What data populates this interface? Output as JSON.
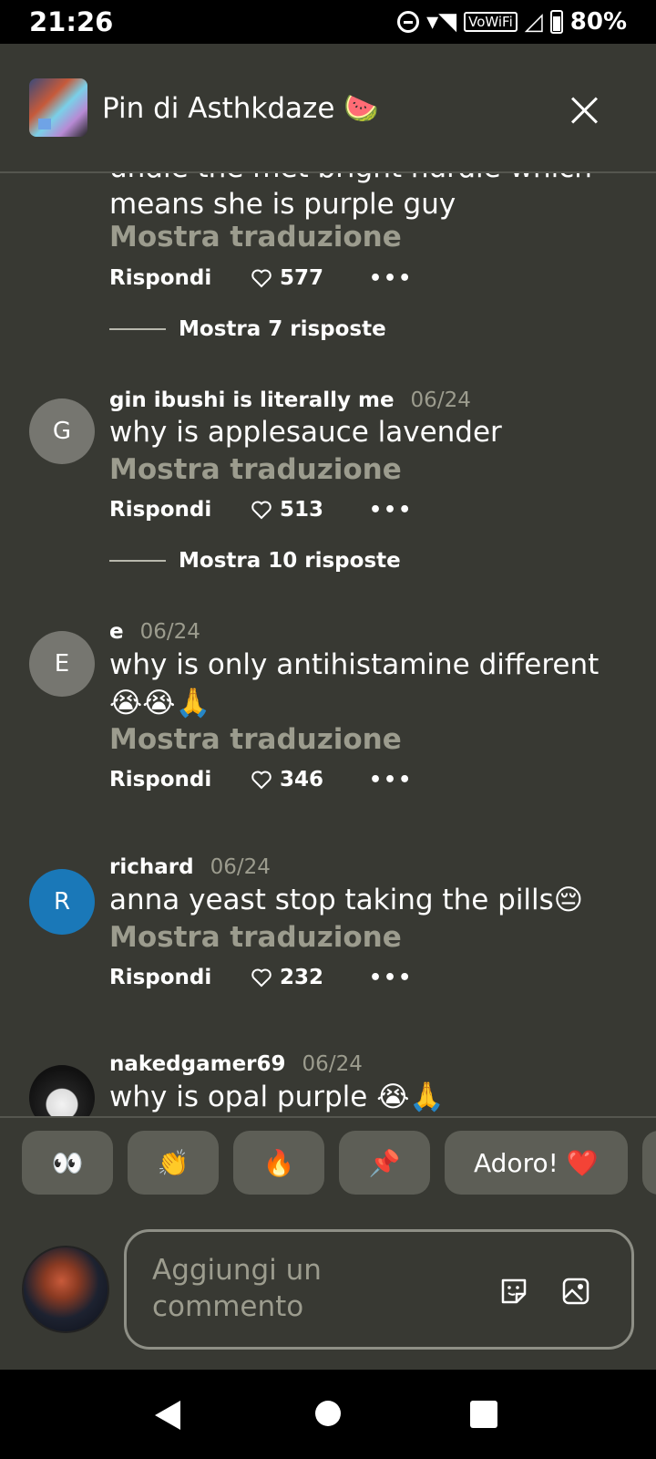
{
  "status_bar": {
    "time": "21:26",
    "network": "VoWiFi",
    "battery": "80%"
  },
  "header": {
    "title": "Pin di Asthkdaze 🍉",
    "close_icon": "close-icon"
  },
  "comments": {
    "partial": {
      "cut_line": "undie the met bright hurdle which",
      "line2": "means she is purple guy",
      "translate": "Mostra traduzione",
      "reply": "Rispondi",
      "likes": "577",
      "show_replies": "Mostra 7 risposte"
    },
    "items": [
      {
        "initial": "G",
        "avatar_color": "#767670",
        "author": "gin ibushi is literally me",
        "date": "06/24",
        "text": "why is applesauce lavender",
        "translate": "Mostra traduzione",
        "reply": "Rispondi",
        "likes": "513",
        "show_replies": "Mostra 10 risposte"
      },
      {
        "initial": "E",
        "avatar_color": "#767670",
        "author": "e",
        "date": "06/24",
        "text": "why is only antihistamine different 😭😭🙏",
        "translate": "Mostra traduzione",
        "reply": "Rispondi",
        "likes": "346"
      },
      {
        "initial": "R",
        "avatar_color": "#1a78b8",
        "author": "richard",
        "date": "06/24",
        "text": "anna yeast stop taking the pills😔",
        "translate": "Mostra traduzione",
        "reply": "Rispondi",
        "likes": "232"
      },
      {
        "author": "nakedgamer69",
        "date": "06/24",
        "text": "why is opal purple 😭🙏"
      }
    ]
  },
  "reactions": [
    "👀",
    "👏",
    "🔥",
    "📌",
    "Adoro! ❤️"
  ],
  "composer": {
    "placeholder": "Aggiungi un commento"
  }
}
